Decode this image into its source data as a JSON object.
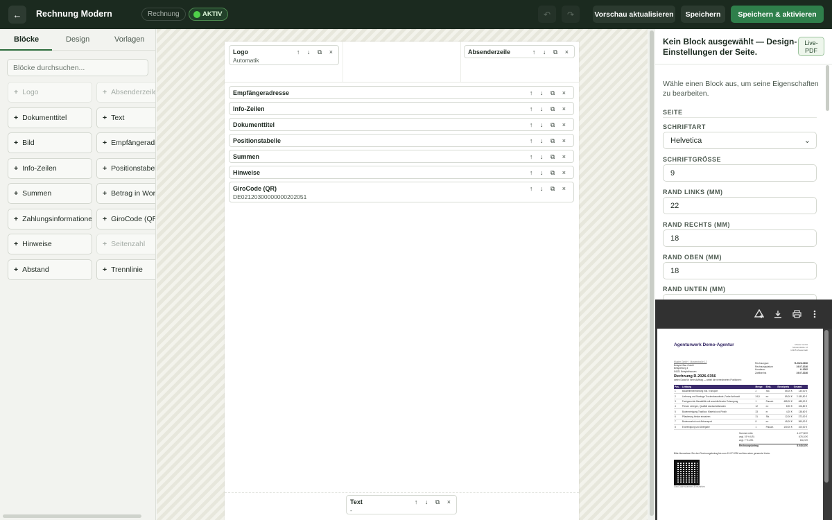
{
  "topbar": {
    "back_icon": "←",
    "title": "Rechnung Modern",
    "type_pill": "Rechnung",
    "status": "AKTIV",
    "undo_icon": "↶",
    "redo_icon": "↷",
    "refresh_label": "Vorschau aktualisieren",
    "save_label": "Speichern",
    "save_activate_label": "Speichern & aktivieren"
  },
  "left": {
    "tabs": [
      "Blöcke",
      "Design",
      "Vorlagen"
    ],
    "search_placeholder": "Blöcke durchsuchen...",
    "blocks": [
      {
        "label": "Logo",
        "disabled": true
      },
      {
        "label": "Absenderzeile",
        "disabled": true
      },
      {
        "label": "Dokumenttitel",
        "disabled": false
      },
      {
        "label": "Text",
        "disabled": false
      },
      {
        "label": "Bild",
        "disabled": false
      },
      {
        "label": "Empfängeradresse",
        "disabled": false
      },
      {
        "label": "Info-Zeilen",
        "disabled": false
      },
      {
        "label": "Positionstabelle",
        "disabled": false
      },
      {
        "label": "Summen",
        "disabled": false
      },
      {
        "label": "Betrag in Worten",
        "disabled": false
      },
      {
        "label": "Zahlungsinformationen",
        "disabled": false
      },
      {
        "label": "GiroCode (QR)",
        "disabled": false
      },
      {
        "label": "Hinweise",
        "disabled": false
      },
      {
        "label": "Seitenzahl",
        "disabled": true
      },
      {
        "label": "Abstand",
        "disabled": false
      },
      {
        "label": "Trennlinie",
        "disabled": false
      }
    ]
  },
  "canvas": {
    "controls": "↑ ↓ ⧉ ×",
    "header_blocks": [
      {
        "name": "Logo",
        "sub": "Automatik"
      },
      {
        "name": "Absenderzeile",
        "sub": ""
      }
    ],
    "body_blocks": [
      {
        "name": "Empfängeradresse",
        "sub": ""
      },
      {
        "name": "Info-Zeilen",
        "sub": ""
      },
      {
        "name": "Dokumenttitel",
        "sub": ""
      },
      {
        "name": "Positionstabelle",
        "sub": ""
      },
      {
        "name": "Summen",
        "sub": ""
      },
      {
        "name": "Hinweise",
        "sub": ""
      },
      {
        "name": "GiroCode (QR)",
        "sub": "DE02120300000000202051"
      }
    ],
    "footer_block": {
      "name": "Text",
      "sub": "-"
    }
  },
  "right": {
    "title": "Kein Block ausgewählt — Design-Einstellungen der Seite.",
    "live_label": "Live-PDF",
    "hint": "Wähle einen Block aus, um seine Eigenschaften zu bearbeiten.",
    "section": "SEITE",
    "fields": [
      {
        "label": "SCHRIFTART",
        "value": "Helvetica",
        "select": true
      },
      {
        "label": "SCHRIFTGRÖSSE",
        "value": "9",
        "select": false
      },
      {
        "label": "RAND LINKS (MM)",
        "value": "22",
        "select": false
      },
      {
        "label": "RAND RECHTS (MM)",
        "value": "18",
        "select": false
      },
      {
        "label": "RAND OBEN (MM)",
        "value": "18",
        "select": false
      },
      {
        "label": "RAND UNTEN (MM)",
        "value": "",
        "select": false
      }
    ]
  },
  "pdf": {
    "company": "Agenturwerk Demo-Agentur",
    "sender_right": [
      "Muster GmbH",
      "Musterstraße 12",
      "12345 Musterstadt"
    ],
    "sender_line": "Muster GmbH · Musterstraße 12",
    "recipient": [
      "Beispiel Bau GmbH",
      "Beispielweg 4",
      "54321 Beispielhausen"
    ],
    "meta": [
      [
        "Rechnungsnr.",
        "R-2026-0356"
      ],
      [
        "Rechnungsdatum",
        "19.07.2026"
      ],
      [
        "Kundennr.",
        "K-1082"
      ],
      [
        "Zahlbar bis",
        "19.07.2026"
      ]
    ],
    "title": "Rechnung R-2026-0356",
    "intro": "vielen Dank für Ihren Auftrag — anbei die verrechneten Positionen:",
    "columns": [
      "Pos.",
      "Leistung",
      "Menge",
      "Einh.",
      "Einzelpreis",
      "Gesamt"
    ],
    "rows": [
      [
        "1",
        "Baustelleneinrichtung inkl. Transport",
        "2",
        "Std.",
        "65,00 €",
        "130,00 €"
      ],
      [
        "2",
        "Lieferung und Montage Trockenbauwände, Farbe Anthrazit",
        "24,5",
        "m²",
        "89,00 €",
        "2.180,50 €"
      ],
      [
        "3",
        "Fachgerechte Bauabfälle mit anschließender Entsorgung",
        "1",
        "Pausch.",
        "485,00 €",
        "485,00 €"
      ],
      [
        "4",
        "Fliesen verlegen, Qualität Landschaftsboden",
        "12",
        "m²",
        "8,90 €",
        "106,80 €"
      ],
      [
        "5",
        "Bodenreinigung Trayfloor, Material und Finish",
        "33",
        "m",
        "4,20 €",
        "138,60 €"
      ],
      [
        "6",
        "Pflasterung Hecke einsetzen",
        "31",
        "Stk.",
        "12,00 €",
        "372,00 €"
      ],
      [
        "7",
        "Bodenaushub und Abtransport",
        "8",
        "m³",
        "45,00 €",
        "360,00 €"
      ],
      [
        "8",
        "Endreinigung und Übergabe",
        "1",
        "Pausch.",
        "100,00 €",
        "100,00 €"
      ]
    ],
    "sums": [
      [
        "Summe netto",
        "4.177,50 €"
      ],
      [
        "zzgl. 19 % USt.",
        "676,10 €"
      ],
      [
        "zzgl. 7 % USt.",
        "84,21 €"
      ]
    ],
    "total_label": "Rechnungsbetrag",
    "total_value": "5.040,02 €",
    "note": "Bitte überweisen Sie den Rechnungsbetrag bis zum 19.07.2026 auf das unten genannte Konto.",
    "qr_caption": "GiroCode scannen & bezahlen"
  },
  "pdf_toolbar": {
    "icons": [
      "drive-add-icon",
      "download-icon",
      "print-icon",
      "more-icon"
    ]
  },
  "colors": {
    "topbar_bg": "#1b2a1f",
    "primary": "#2f7f4b",
    "status_green": "#4fd04a",
    "pdf_accent": "#3a2a6b"
  }
}
